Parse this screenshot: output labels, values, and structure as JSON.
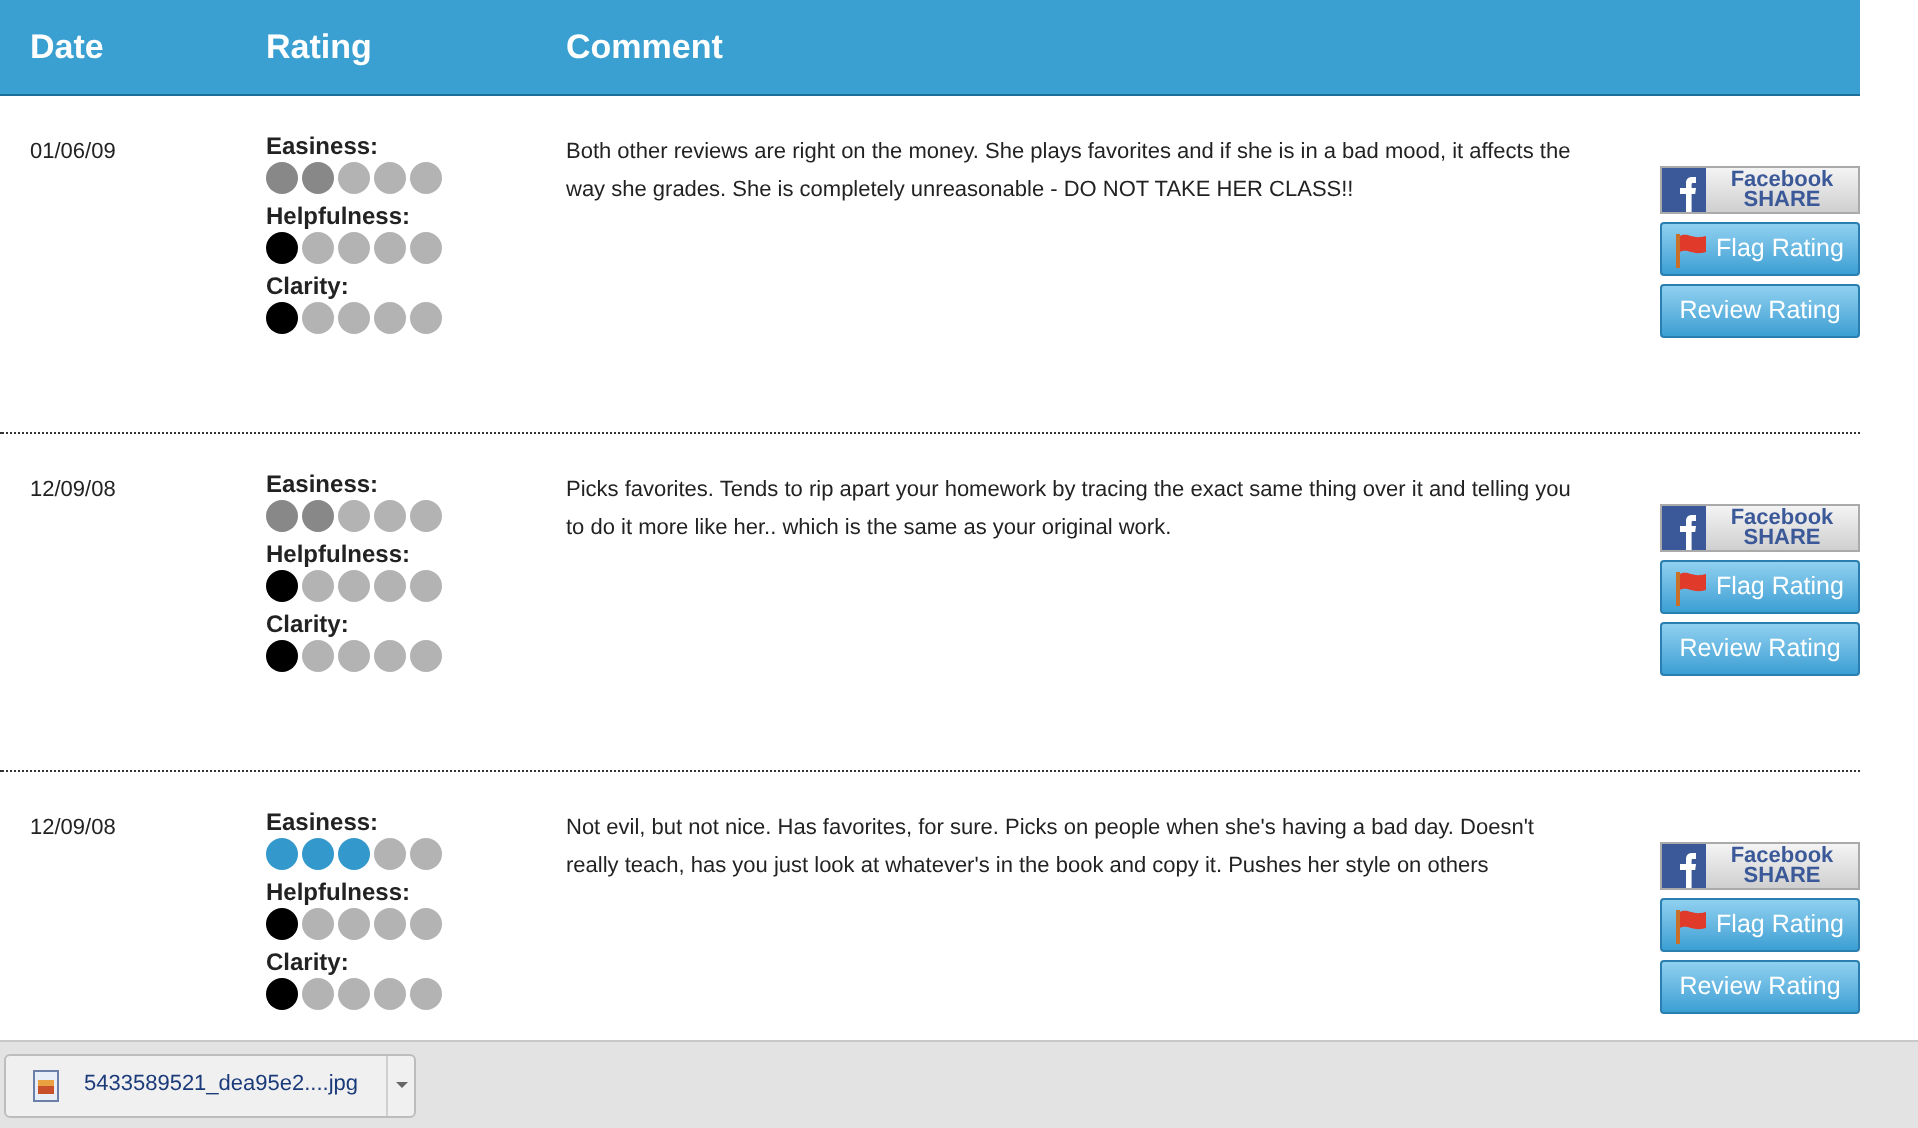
{
  "header": {
    "columns": [
      "Date",
      "Rating",
      "Comment"
    ]
  },
  "reviews": [
    {
      "date": "01/06/09",
      "ratings": [
        {
          "label": "Easiness:",
          "stars": 2,
          "color": "#888888"
        },
        {
          "label": "Helpfulness:",
          "stars": 1,
          "color": "#000000"
        },
        {
          "label": "Clarity:",
          "stars": 1,
          "color": "#000000"
        }
      ],
      "comment": "Both other reviews are right on the money. She plays favorites and if she is in a bad mood, it affects the way she grades. She is completely unreasonable - DO NOT TAKE HER CLASS!!",
      "share": [
        "Facebook",
        "SHARE"
      ],
      "buttons": [
        "Flag Rating",
        "Review Rating"
      ]
    },
    {
      "date": "12/09/08",
      "ratings": [
        {
          "label": "Easiness:",
          "stars": 2,
          "color": "#888888"
        },
        {
          "label": "Helpfulness:",
          "stars": 1,
          "color": "#000000"
        },
        {
          "label": "Clarity:",
          "stars": 1,
          "color": "#000000"
        }
      ],
      "comment": "Picks favorites. Tends to rip apart your homework by tracing the exact same thing over it and telling you to do it more like her.. which is the same as your original work.",
      "share": [
        "Facebook",
        "SHARE"
      ],
      "buttons": [
        "Flag Rating",
        "Review Rating"
      ]
    },
    {
      "date": "12/09/08",
      "ratings": [
        {
          "label": "Easiness:",
          "stars": 3,
          "color": "#3399cc"
        },
        {
          "label": "Helpfulness:",
          "stars": 1,
          "color": "#000000"
        },
        {
          "label": "Clarity:",
          "stars": 1,
          "color": "#000000"
        }
      ],
      "comment": "Not evil, but not nice. Has favorites, for sure. Picks on people when she's having a bad day. Doesn't really teach, has you just look at whatever's in the book and copy it. Pushes her style on others",
      "share": [
        "Facebook",
        "SHARE"
      ],
      "buttons": [
        "Flag Rating",
        "Review Rating"
      ]
    }
  ],
  "download_bar": {
    "file": "5433589521_dea95e2....jpg"
  }
}
